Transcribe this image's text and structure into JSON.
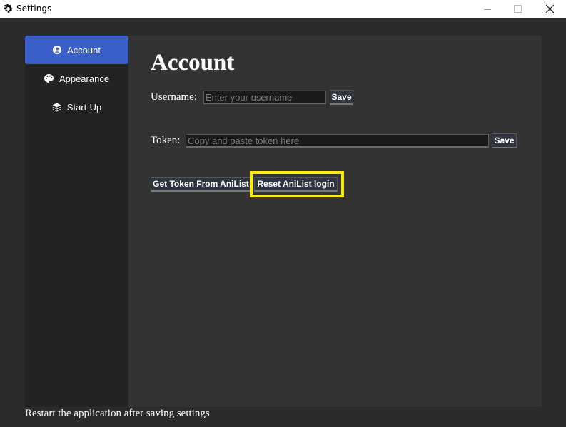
{
  "window": {
    "title": "Settings",
    "app_icon": "gear-icon",
    "controls": [
      "minimize-icon",
      "maximize-icon",
      "close-icon"
    ]
  },
  "sidebar": {
    "items": [
      {
        "label": "Account",
        "icon": "user-circle-icon",
        "active": true
      },
      {
        "label": "Appearance",
        "icon": "palette-icon",
        "active": false
      },
      {
        "label": "Start-Up",
        "icon": "layers-icon",
        "active": false
      }
    ]
  },
  "main": {
    "heading": "Account",
    "username": {
      "label": "Username:",
      "placeholder": "Enter your username",
      "value": "",
      "save_label": "Save"
    },
    "token": {
      "label": "Token:",
      "placeholder": "Copy and paste token here",
      "value": "",
      "save_label": "Save"
    },
    "get_token_label": "Get Token From AniList",
    "reset_label": "Reset AniList login"
  },
  "footer": {
    "text": "Restart the application after saving settings"
  },
  "colors": {
    "background": "#2b2b2b",
    "sidebar": "#232323",
    "content": "#333333",
    "accent": "#3a5fc9",
    "highlight": "#ffee00"
  }
}
